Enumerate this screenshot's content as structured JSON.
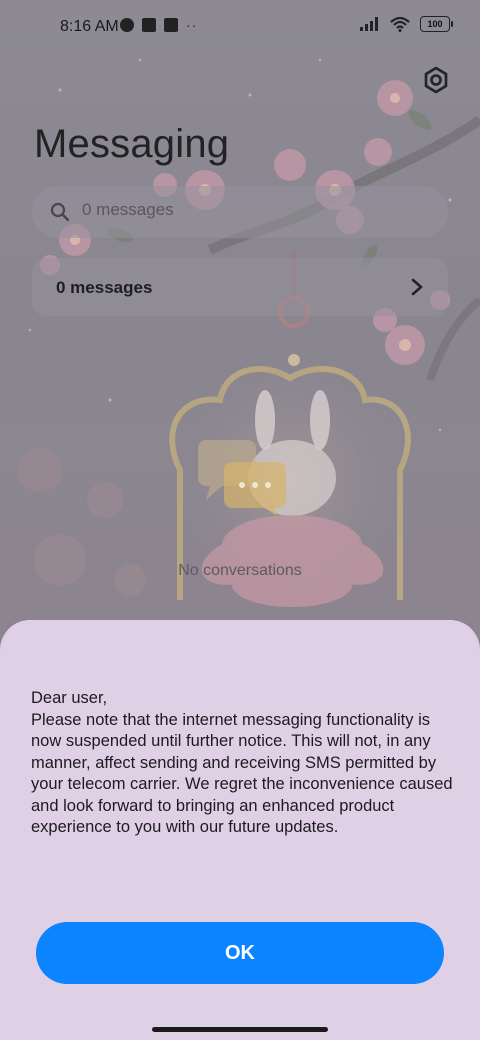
{
  "status_bar": {
    "time": "8:16 AM",
    "battery": "100"
  },
  "app": {
    "title": "Messaging"
  },
  "search": {
    "placeholder": "0 messages"
  },
  "messages_row": {
    "label": "0 messages"
  },
  "empty_state": {
    "text": "No conversations"
  },
  "dialog": {
    "body": "Dear user,\nPlease note that the internet messaging functionality is now suspended until further notice. This will not, in any manner, affect sending and receiving SMS permitted by your telecom carrier. We regret the inconvenience caused and look forward to bringing an enhanced product experience to you with our future updates.",
    "ok_label": "OK"
  },
  "colors": {
    "accent": "#0d84ff",
    "sheet_background": "#e0d0e6"
  },
  "icons": [
    "settings-icon",
    "search-icon",
    "chevron-right-icon",
    "chat-bubbles-icon",
    "wifi-icon",
    "signal-icon",
    "battery-icon"
  ]
}
